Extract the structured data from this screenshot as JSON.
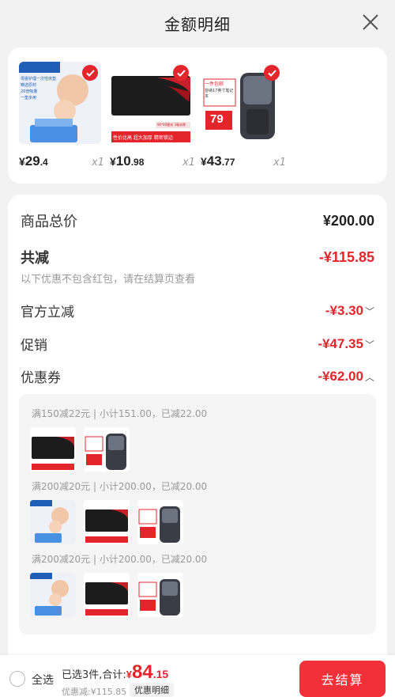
{
  "header": {
    "title": "金额明细"
  },
  "products": [
    {
      "price_int": "29",
      "price_dec": ".4",
      "qty": "x1",
      "img_texts": [
        "母婴护理一次性床垫",
        "精选原材",
        "20倍吸量",
        "一垫多用"
      ]
    },
    {
      "price_int": "10",
      "price_dec": ".98",
      "qty": "x1",
      "img_texts": [
        "90*40厘米 3毫米厚",
        "性价比高 超大加厚 精密锁边"
      ]
    },
    {
      "price_int": "43",
      "price_dec": ".77",
      "qty": "x1",
      "img_texts": [
        "一件包邮",
        "容纳17英寸笔记本",
        "79"
      ]
    }
  ],
  "currency": "¥",
  "summary": {
    "total_label": "商品总价",
    "total_value": "¥200.00",
    "reduce_label": "共减",
    "reduce_value": "-¥115.85",
    "note": "以下优惠不包含红包，请在结算页查看",
    "official_label": "官方立减",
    "official_value": "-¥3.30",
    "promo_label": "促销",
    "promo_value": "-¥47.35",
    "coupon_label": "优惠券",
    "coupon_value": "-¥62.00"
  },
  "coupons": [
    {
      "title": "满150减22元 | 小计151.00，已减22.00"
    },
    {
      "title": "满200减20元 | 小计200.00，已减20.00"
    },
    {
      "title": "满200减20元 | 小计200.00，已减20.00"
    }
  ],
  "footer": {
    "select_all": "全选",
    "selected_text": "已选3件,合计:",
    "total_int": "84",
    "total_dec": ".15",
    "discount_text": "优惠减:¥115.85",
    "detail_button": "优惠明细",
    "checkout_button": "去结算"
  },
  "colors": {
    "accent": "#e5252c",
    "checkout_bg": "#f2303a"
  }
}
